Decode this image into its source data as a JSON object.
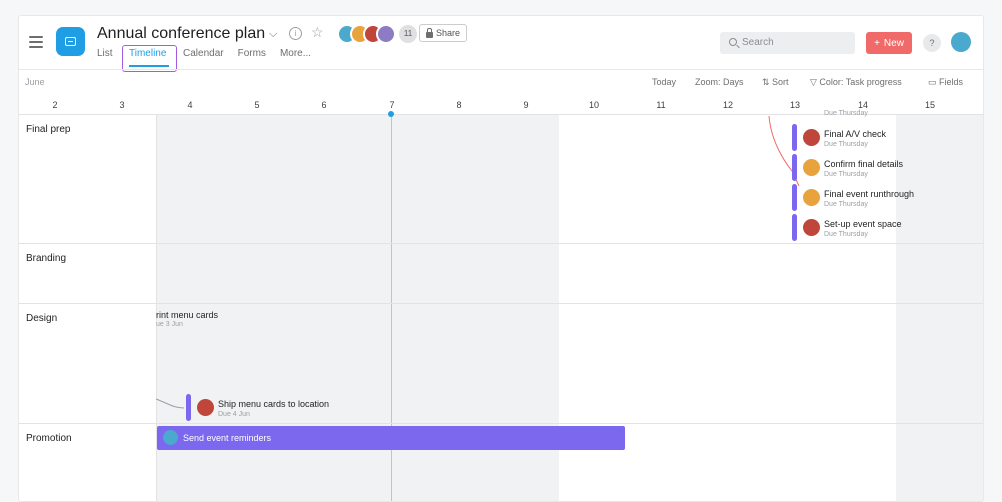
{
  "header": {
    "project_title": "Annual conference plan",
    "member_count": "11",
    "share_label": "Share",
    "tabs": [
      "List",
      "Timeline",
      "Calendar",
      "Forms",
      "More..."
    ],
    "active_tab": "Timeline",
    "search_placeholder": "Search",
    "new_label": "New",
    "help_label": "?"
  },
  "toolbar": {
    "month": "June",
    "today": "Today",
    "zoom": "Zoom: Days",
    "sort": "Sort",
    "color": "Color: Task progress",
    "fields": "Fields"
  },
  "dates": [
    "2",
    "3",
    "4",
    "5",
    "6",
    "7",
    "8",
    "9",
    "10",
    "11",
    "12",
    "13",
    "14",
    "15"
  ],
  "sections": [
    "Final prep",
    "Branding",
    "Design",
    "Promotion"
  ],
  "tasks": {
    "t0_due": "Due Thursday",
    "t1_name": "Final A/V check",
    "t1_due": "Due Thursday",
    "t2_name": "Confirm final details",
    "t2_due": "Due Thursday",
    "t3_name": "Final event runthrough",
    "t3_due": "Due Thursday",
    "t4_name": "Set-up event space",
    "t4_due": "Due Thursday",
    "print_name": "rint menu cards",
    "print_due": "ue 3 Jun",
    "ship_name": "Ship menu cards to location",
    "ship_due": "Due 4 Jun",
    "reminders_name": "Send event reminders"
  },
  "colors": {
    "accent_blue": "#1f9ee6",
    "task_bar": "#7b68ee",
    "new_button": "#f06a6a",
    "active_tab_outline": "#a25ddc"
  }
}
